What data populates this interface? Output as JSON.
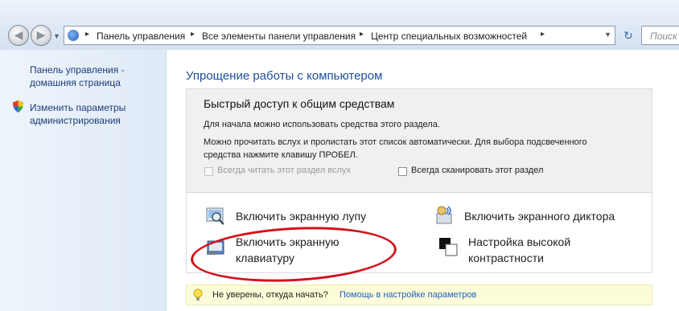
{
  "address_bar": {
    "breadcrumbs": [
      "Панель управления",
      "Все элементы панели управления",
      "Центр специальных возможностей"
    ]
  },
  "search": {
    "placeholder": "Поиск"
  },
  "sidebar": {
    "home_link": [
      "Панель управления -",
      "домашняя страница"
    ],
    "admin_link": [
      "Изменить параметры",
      "администрирования"
    ]
  },
  "main": {
    "title": "Упрощение работы с компьютером",
    "quick_access": {
      "heading": "Быстрый доступ к общим средствам",
      "text1": "Для начала можно использовать средства этого раздела.",
      "text2": "Можно прочитать вслух и пролистать этот список автоматически. Для выбора подсвеченного средства нажмите клавишу ПРОБЕЛ.",
      "checkbox_read": "Всегда читать этот раздел вслух",
      "checkbox_scan": "Всегда сканировать этот раздел"
    },
    "tools": {
      "magnifier": "Включить экранную лупу",
      "narrator": "Включить экранного диктора",
      "keyboard": [
        "Включить экранную",
        "клавиатуру"
      ],
      "contrast": [
        "Настройка высокой",
        "контрастности"
      ]
    },
    "hint": {
      "text": "Не уверены, откуда начать?",
      "link": "Помощь в настройке параметров"
    }
  },
  "icons": {
    "back": "back-arrow-icon",
    "forward": "forward-arrow-icon",
    "refresh": "refresh-icon",
    "shield": "uac-shield-icon",
    "bulb": "lightbulb-icon"
  },
  "colors": {
    "link": "#1c3d77",
    "title": "#1c4f9c",
    "highlight_oval": "#d3121a"
  }
}
